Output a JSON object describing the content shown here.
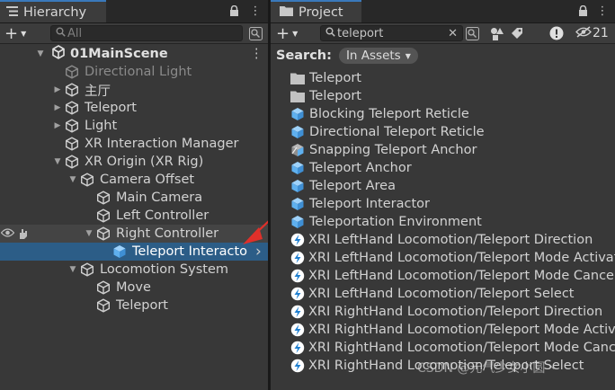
{
  "hierarchy": {
    "tab_title": "Hierarchy",
    "search_placeholder": "All",
    "add_label": "+",
    "scene_name": "01MainScene",
    "items": [
      {
        "label": "Directional Light",
        "dim": true
      },
      {
        "label": "主厅"
      },
      {
        "label": "Teleport"
      },
      {
        "label": "Light"
      },
      {
        "label": "XR Interaction Manager"
      },
      {
        "label": "XR Origin (XR Rig)"
      },
      {
        "label": "Camera Offset"
      },
      {
        "label": "Main Camera"
      },
      {
        "label": "Left Controller"
      },
      {
        "label": "Right Controller"
      },
      {
        "label": "Teleport Interacto"
      },
      {
        "label": "Locomotion System"
      },
      {
        "label": "Move"
      },
      {
        "label": "Teleport"
      }
    ]
  },
  "project": {
    "tab_title": "Project",
    "add_label": "+",
    "search_value": "teleport",
    "hidden_count": "21",
    "search_label": "Search:",
    "scope_label": "In Assets",
    "items": [
      {
        "label": "Teleport",
        "icon": "folder-icon"
      },
      {
        "label": "Teleport",
        "icon": "folder-icon"
      },
      {
        "label": "Blocking Teleport Reticle",
        "icon": "prefab-icon"
      },
      {
        "label": "Directional Teleport Reticle",
        "icon": "prefab-icon"
      },
      {
        "label": "Snapping Teleport Anchor",
        "icon": "prefab-variant-icon"
      },
      {
        "label": "Teleport Anchor",
        "icon": "prefab-icon"
      },
      {
        "label": "Teleport Area",
        "icon": "prefab-icon"
      },
      {
        "label": "Teleport Interactor",
        "icon": "prefab-icon"
      },
      {
        "label": "Teleportation Environment",
        "icon": "prefab-icon"
      },
      {
        "label": "XRI LeftHand Locomotion/Teleport Direction",
        "icon": "input-action-icon"
      },
      {
        "label": "XRI LeftHand Locomotion/Teleport Mode Activate",
        "icon": "input-action-icon"
      },
      {
        "label": "XRI LeftHand Locomotion/Teleport Mode Cancel",
        "icon": "input-action-icon"
      },
      {
        "label": "XRI LeftHand Locomotion/Teleport Select",
        "icon": "input-action-icon"
      },
      {
        "label": "XRI RightHand Locomotion/Teleport Direction",
        "icon": "input-action-icon"
      },
      {
        "label": "XRI RightHand Locomotion/Teleport Mode Activate",
        "icon": "input-action-icon"
      },
      {
        "label": "XRI RightHand Locomotion/Teleport Mode Cancel",
        "icon": "input-action-icon"
      },
      {
        "label": "XRI RightHand Locomotion/Teleport Select",
        "icon": "input-action-icon"
      }
    ]
  },
  "watermark": "CSDN @元气少女小圆丶",
  "colors": {
    "selection": "#2c5d87",
    "arrow": "#e0302a",
    "prefab": "#5fb0ef",
    "tab_accent": "#3a79bb"
  }
}
